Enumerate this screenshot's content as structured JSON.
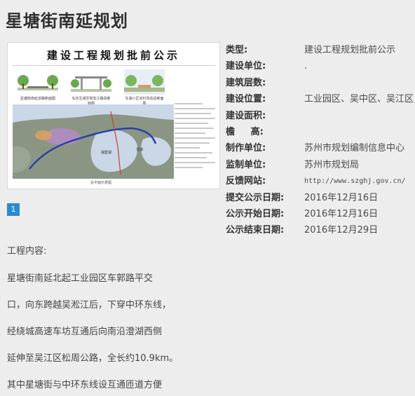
{
  "page": {
    "title": "星塘街南延规划"
  },
  "preview": {
    "banner": "建设工程规划批前公示",
    "section_labels": [
      "星塘街南延道路断面图",
      "车坊互通至吴淞江路段断面图",
      "东湖小区旧村改造段断面图"
    ],
    "caption": "总平面示意图"
  },
  "pager": {
    "current": "1"
  },
  "info": {
    "rows": [
      {
        "label": "类型:",
        "value": "建设工程规划批前公示"
      },
      {
        "label": "建设单位:",
        "value": "."
      },
      {
        "label": "建筑层数:",
        "value": ""
      },
      {
        "label": "建设位置:",
        "value": "工业园区、吴中区、吴江区"
      },
      {
        "label": "建设面积:",
        "value": ""
      },
      {
        "label": "檐     高:",
        "value": ""
      },
      {
        "label": "制作单位:",
        "value": "苏州市规划编制信息中心"
      },
      {
        "label": "监制单位:",
        "value": "苏州市规划局"
      },
      {
        "label": "反馈网站:",
        "value": "http://www.szghj.gov.cn/"
      },
      {
        "label": "提交公示日期:",
        "value": "2016年12月16日"
      },
      {
        "label": "公示开始日期:",
        "value": "2016年12月16日"
      },
      {
        "label": "公示结束日期:",
        "value": "2016年12月29日"
      }
    ]
  },
  "content": {
    "heading": "工程内容:",
    "paragraphs": [
      "星塘街南延北起工业园区车郭路平交",
      "口，向东跨越吴淞江后，下穿中环东线，",
      "经绕城高速车坊互通后向南沿澄湖西侧",
      "延伸至吴江区松周公路，全长约10.9km。",
      "其中星塘街与中环东线设互通匝道方便"
    ]
  }
}
